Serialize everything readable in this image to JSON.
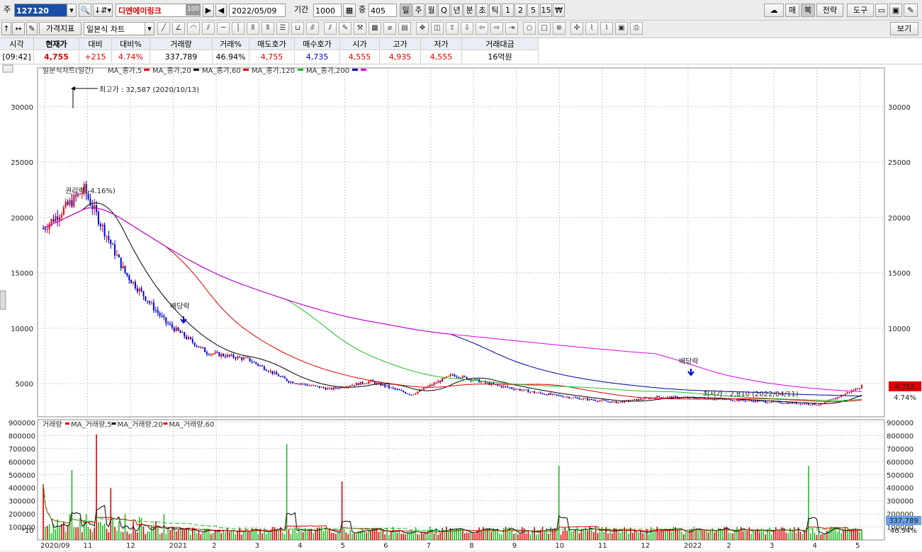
{
  "toolbar": {
    "market_label": "주",
    "code": "127120",
    "stock_name": "디엔에이링크",
    "stock_badge": "100",
    "date": "2022/05/09",
    "period_label": "기간",
    "period_value": "1000",
    "mid_label": "중",
    "mid_value": "405",
    "periods": [
      "일",
      "주",
      "월",
      "Q",
      "년",
      "분",
      "초",
      "틱",
      "1",
      "2",
      "5",
      "15",
      "₩"
    ],
    "active_period": "일",
    "right_buttons": [
      "매",
      "복",
      "전략",
      "도구"
    ],
    "indicator_label": "가격지표",
    "chart_type": "일본식 차트",
    "view_label": "보기"
  },
  "quote": {
    "headers": [
      "시각",
      "현재가",
      "대비",
      "대비%",
      "거래량",
      "거래%",
      "매도호가",
      "매수호가",
      "시가",
      "고가",
      "저가",
      "거래대금"
    ],
    "values": [
      "[09:42]",
      "4,755",
      "+215",
      "4.74%",
      "337,789",
      "46.94%",
      "4,755",
      "4,735",
      "4,555",
      "4,935",
      "4,555",
      "16억원"
    ]
  },
  "chart_data": {
    "type": "candlestick",
    "main": {
      "legend_title": "일본식차트(일간)",
      "series_legend": [
        {
          "name": "MA_종가,5",
          "color": "#e00000"
        },
        {
          "name": "MA_종가,20",
          "color": "#000000"
        },
        {
          "name": "MA_종가,60",
          "color": "#e00000"
        },
        {
          "name": "MA_종가,120",
          "color": "#22bb22"
        },
        {
          "name": "MA_종가,200",
          "color": "#0000a0"
        },
        {
          "name": "",
          "color": "#e000e0"
        }
      ],
      "y_ticks": [
        5000,
        10000,
        15000,
        20000,
        25000,
        30000
      ],
      "ylim": [
        2000,
        33500
      ],
      "x_ticks": [
        "2020/09",
        "11",
        "12",
        "2021",
        "2",
        "3",
        "4",
        "5",
        "6",
        "7",
        "8",
        "9",
        "10",
        "11",
        "12",
        "2022",
        "2",
        "3",
        "4",
        "5"
      ],
      "annotations": [
        {
          "text": "최고가 : 32,587 (2020/10/13)",
          "color": "#e00000"
        },
        {
          "text": "권리락(-4.16%)",
          "color": "#000000"
        },
        {
          "text": "배당락",
          "color": "#000000"
        },
        {
          "text": "배당락",
          "color": "#000000"
        },
        {
          "text": "최저가 : 2,810 (2022/04/11)",
          "color": "#0000d0"
        }
      ],
      "last_price_label": "4,755",
      "last_change_label": "4.74%",
      "close_monthly": [
        {
          "x": "2020/09",
          "close": 19000
        },
        {
          "x": "2020/10",
          "close": 22500
        },
        {
          "x": "2020/11",
          "close": 15000
        },
        {
          "x": "2020/12",
          "close": 10500
        },
        {
          "x": "2021/01",
          "close": 7800
        },
        {
          "x": "2021/02",
          "close": 7200
        },
        {
          "x": "2021/03",
          "close": 5200
        },
        {
          "x": "2021/04",
          "close": 4500
        },
        {
          "x": "2021/05",
          "close": 5200
        },
        {
          "x": "2021/06",
          "close": 4000
        },
        {
          "x": "2021/07",
          "close": 5800
        },
        {
          "x": "2021/08",
          "close": 4900
        },
        {
          "x": "2021/09",
          "close": 4200
        },
        {
          "x": "2021/10",
          "close": 3700
        },
        {
          "x": "2021/11",
          "close": 3300
        },
        {
          "x": "2021/12",
          "close": 3800
        },
        {
          "x": "2022/01",
          "close": 3700
        },
        {
          "x": "2022/02",
          "close": 3500
        },
        {
          "x": "2022/03",
          "close": 3300
        },
        {
          "x": "2022/04",
          "close": 3100
        },
        {
          "x": "2022/05",
          "close": 4755
        }
      ]
    },
    "volume": {
      "legend_title": "거래량",
      "series_legend": [
        {
          "name": "MA_거래량,5",
          "color": "#e00000"
        },
        {
          "name": "MA_거래량,20",
          "color": "#000000"
        },
        {
          "name": "MA_거래량,60",
          "color": "#e00000"
        }
      ],
      "y_ticks": [
        100000,
        200000,
        300000,
        400000,
        500000,
        600000,
        700000,
        800000,
        900000
      ],
      "ylim": [
        0,
        900000
      ],
      "multiplier_label": "*10",
      "last_volume_label": "337,789",
      "last_pct_label": "46.94%"
    }
  }
}
